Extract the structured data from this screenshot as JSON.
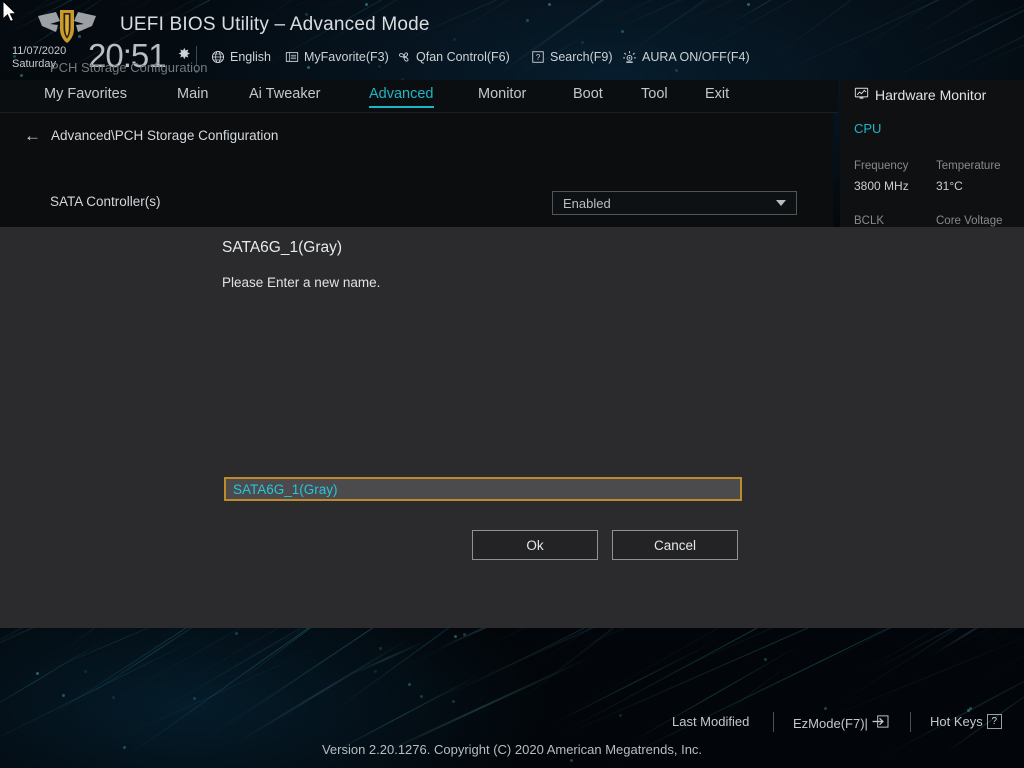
{
  "header": {
    "title": "UEFI BIOS Utility – Advanced Mode",
    "logo_name": "tuf-gaming-logo",
    "date": "11/07/2020",
    "weekday": "Saturday",
    "time": "20:51",
    "gear_icon": "gear-icon",
    "shortcuts": [
      {
        "label": "English",
        "icon": "globe-icon"
      },
      {
        "label": "MyFavorite(F3)",
        "icon": "list-icon"
      },
      {
        "label": "Qfan Control(F6)",
        "icon": "fan-icon"
      },
      {
        "label": "Search(F9)",
        "icon": "question-box-icon"
      },
      {
        "label": "AURA ON/OFF(F4)",
        "icon": "aura-light-icon"
      }
    ]
  },
  "nav": {
    "tabs": [
      {
        "label": "My Favorites",
        "active": false
      },
      {
        "label": "Main",
        "active": false
      },
      {
        "label": "Ai Tweaker",
        "active": false
      },
      {
        "label": "Advanced",
        "active": true
      },
      {
        "label": "Monitor",
        "active": false
      },
      {
        "label": "Boot",
        "active": false
      },
      {
        "label": "Tool",
        "active": false
      },
      {
        "label": "Exit",
        "active": false
      }
    ],
    "active_color": "#1fb6c4"
  },
  "content": {
    "back_arrow": "←",
    "breadcrumb": "Advanced\\PCH Storage Configuration",
    "section_label": "PCH Storage Configuration",
    "sata_controller_label": "SATA Controller(s)",
    "sata_controller_value": "Enabled"
  },
  "hardware_monitor": {
    "title": "Hardware Monitor",
    "title_icon": "monitor-icon",
    "group": "CPU",
    "rows": [
      {
        "label": "Frequency",
        "value": "3800 MHz"
      },
      {
        "label": "Temperature",
        "value": "31°C"
      },
      {
        "label": "BCLK",
        "value": ""
      },
      {
        "label": "Core Voltage",
        "value": ""
      }
    ]
  },
  "modal": {
    "title": "SATA6G_1(Gray)",
    "prompt": "Please Enter a new name.",
    "input_value": "SATA6G_1(Gray)",
    "input_border_color": "#c08a2a",
    "input_text_color": "#29c4dd",
    "ok_label": "Ok",
    "cancel_label": "Cancel"
  },
  "footer": {
    "last_modified": "Last Modified",
    "ezmode": "EzMode(F7)|",
    "ezmode_icon": "exit-arrow-icon",
    "hot_keys": "Hot Keys",
    "hot_keys_icon": "question-box-icon",
    "version": "Version 2.20.1276. Copyright (C) 2020 American Megatrends, Inc."
  }
}
